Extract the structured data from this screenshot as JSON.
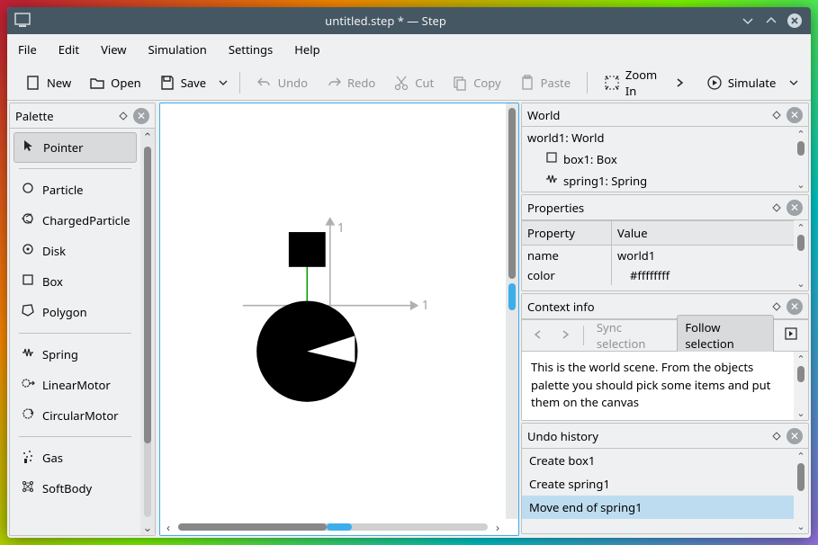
{
  "window": {
    "title": "untitled.step * — Step"
  },
  "menus": {
    "file": "File",
    "edit": "Edit",
    "view": "View",
    "simulation": "Simulation",
    "settings": "Settings",
    "help": "Help"
  },
  "toolbar": {
    "new": "New",
    "open": "Open",
    "save": "Save",
    "undo": "Undo",
    "redo": "Redo",
    "cut": "Cut",
    "copy": "Copy",
    "paste": "Paste",
    "zoom_in": "Zoom In",
    "simulate": "Simulate"
  },
  "palette": {
    "title": "Palette",
    "pointer": "Pointer",
    "particle": "Particle",
    "charged_particle": "ChargedParticle",
    "disk": "Disk",
    "box": "Box",
    "polygon": "Polygon",
    "spring": "Spring",
    "linear_motor": "LinearMotor",
    "circular_motor": "CircularMotor",
    "gas": "Gas",
    "soft_body": "SoftBody"
  },
  "canvas": {
    "axis_x_label": "1",
    "axis_y_label": "1"
  },
  "world_panel": {
    "title": "World",
    "root": "world1: World",
    "box": "box1: Box",
    "spring": "spring1: Spring"
  },
  "properties": {
    "title": "Properties",
    "header_prop": "Property",
    "header_val": "Value",
    "rows": [
      {
        "prop": "name",
        "val": "world1"
      },
      {
        "prop": "color",
        "val": "#ffffffff"
      }
    ]
  },
  "context": {
    "title": "Context info",
    "sync": "Sync selection",
    "follow": "Follow selection",
    "text": "This is the world scene. From the objects palette you should pick some items and put them on the canvas"
  },
  "undo": {
    "title": "Undo history",
    "items": [
      "Create box1",
      "Create spring1",
      "Move end of spring1"
    ],
    "selected_index": 2
  }
}
